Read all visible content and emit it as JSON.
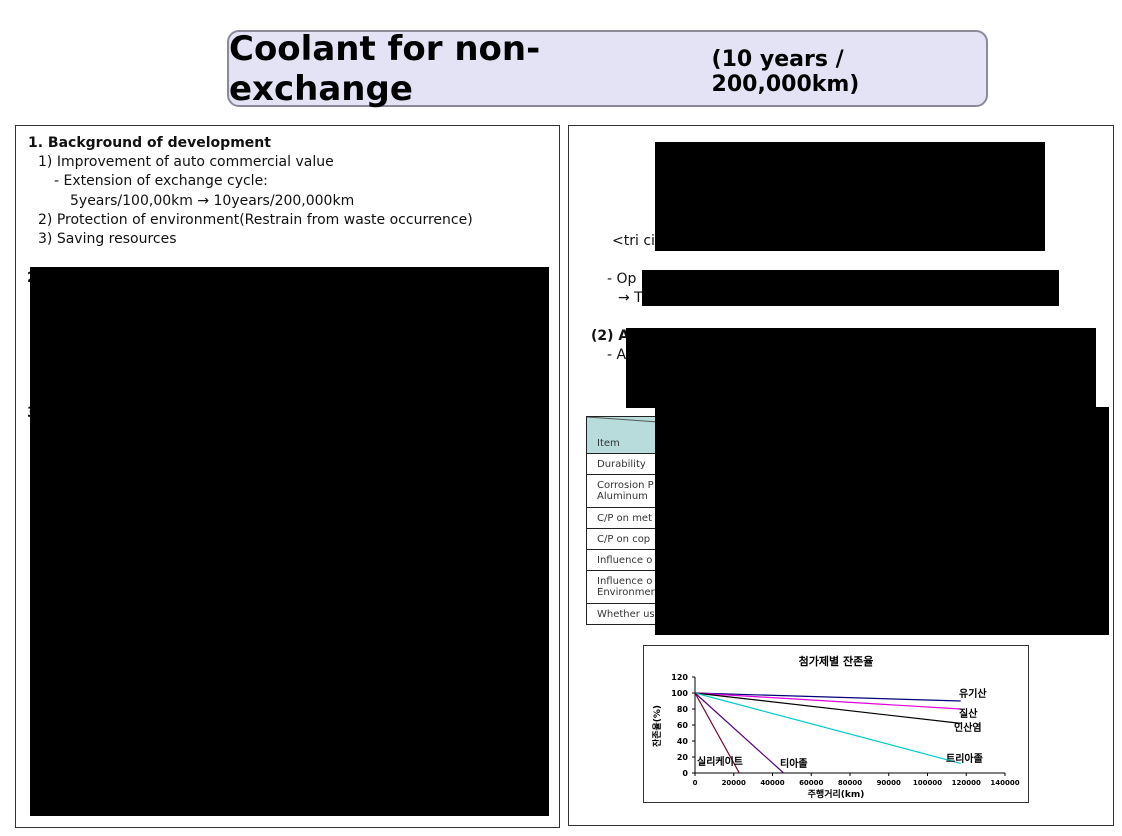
{
  "title": {
    "main": "Coolant for non-exchange",
    "sub": "(10 years / 200,000km)"
  },
  "left_panel": {
    "heading": "1. Background of development",
    "items": [
      "1) Improvement of auto commercial value",
      "- Extension of exchange cycle:",
      "5years/100,00km → 10years/200,000km",
      "2) Protection of environment(Restrain from waste occurrence)",
      "3) Saving resources"
    ],
    "partial_2": "2",
    "partial_3": "3"
  },
  "right_panel": {
    "fragment_tri": "<tri ci",
    "fragment_op": "- Op",
    "fragment_arrow": "→ T",
    "fragment_2a": "(2) A",
    "fragment_dash": "- A",
    "table_rows": [
      "Item",
      "Durability",
      "Corrosion P",
      "Aluminum",
      "C/P on met",
      "C/P on cop",
      "Influence o",
      "Influence o",
      "Environmen",
      "Whether us"
    ]
  },
  "chart_data": {
    "type": "line",
    "title": "첨가제별 잔존율",
    "xlabel": "주행거리(km)",
    "ylabel": "잔존율(%)",
    "xlim": [
      0,
      140000
    ],
    "ylim": [
      0,
      120
    ],
    "xticks": [
      "0",
      "20000",
      "40000",
      "60000",
      "80000",
      "90000",
      "100000",
      "120000",
      "140000"
    ],
    "yticks": [
      "0",
      "20",
      "40",
      "60",
      "80",
      "100",
      "120"
    ],
    "series": [
      {
        "name": "유기산",
        "color": "#00007a",
        "x": [
          0,
          120000
        ],
        "y": [
          100,
          90
        ]
      },
      {
        "name": "질산",
        "color": "#e000e0",
        "x": [
          0,
          120000
        ],
        "y": [
          100,
          80
        ]
      },
      {
        "name": "인산염",
        "color": "#000000",
        "x": [
          0,
          120000
        ],
        "y": [
          100,
          62
        ]
      },
      {
        "name": "트리아졸",
        "color": "#00cccc",
        "x": [
          0,
          120000
        ],
        "y": [
          100,
          12
        ]
      },
      {
        "name": "티아졸",
        "color": "#5a0080",
        "x": [
          0,
          40000
        ],
        "y": [
          100,
          0
        ]
      },
      {
        "name": "실리케이트",
        "color": "#7a0030",
        "x": [
          0,
          20000
        ],
        "y": [
          100,
          0
        ]
      }
    ]
  }
}
